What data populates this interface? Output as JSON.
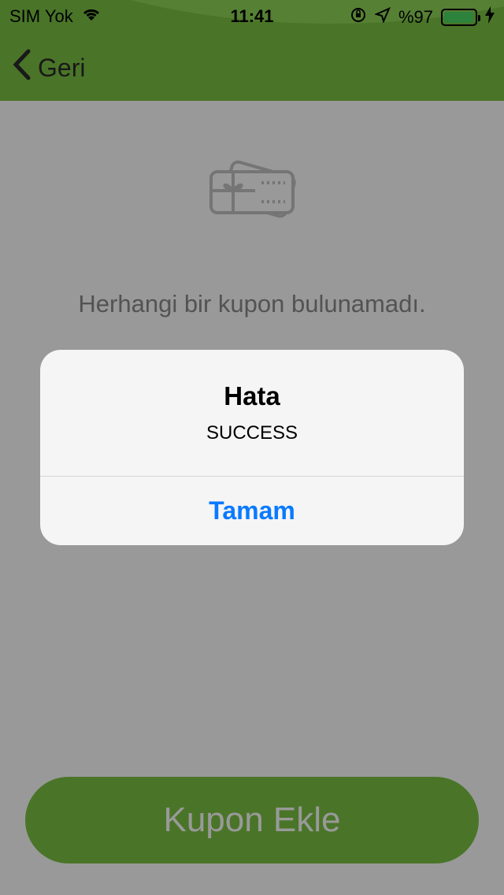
{
  "status_bar": {
    "carrier": "SIM Yok",
    "time": "11:41",
    "battery": "%97",
    "battery_level": 0.97,
    "icons": [
      "wifi-icon",
      "orientation-lock-icon",
      "location-arrow-icon",
      "battery-icon",
      "charging-bolt-icon"
    ]
  },
  "nav": {
    "back_label": "Geri",
    "back_icon": "chevron-left-icon"
  },
  "main": {
    "empty_icon": "gift-card-icon",
    "empty_message": "Herhangi bir kupon bulunamadı.",
    "add_button_label": "Kupon Ekle"
  },
  "alert": {
    "title": "Hata",
    "message": "SUCCESS",
    "ok_label": "Tamam"
  },
  "colors": {
    "header_green": "#7cc444",
    "button_green": "#7cc444",
    "link_blue": "#0a7aff",
    "battery_green": "#4cd964"
  }
}
